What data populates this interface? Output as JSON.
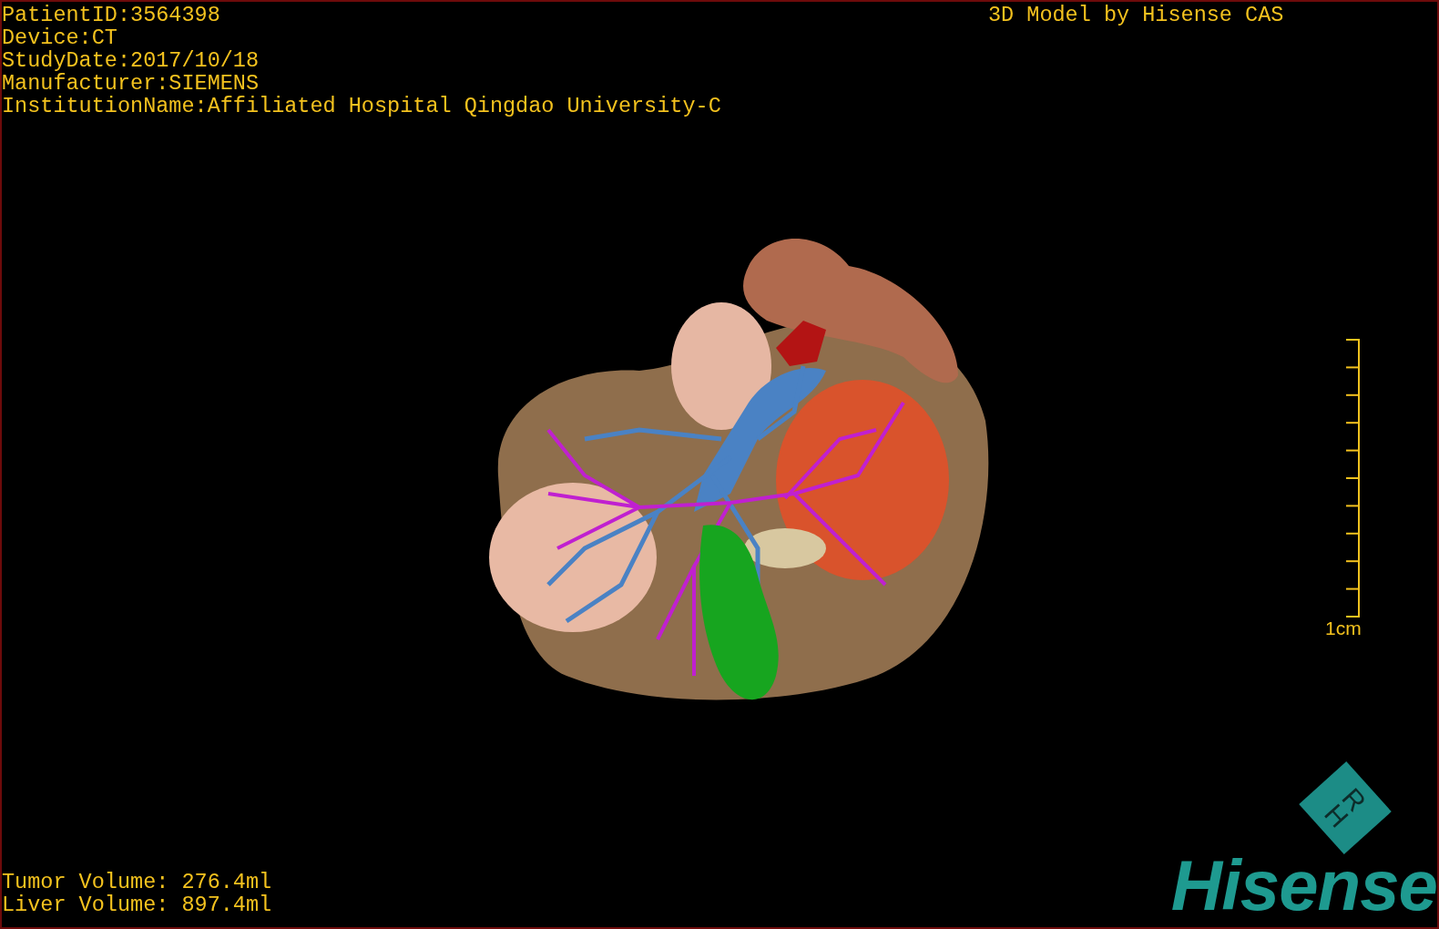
{
  "patient_info": [
    "PatientID:3564398",
    "Device:CT",
    "StudyDate:2017/10/18",
    "Manufacturer:SIEMENS",
    "InstitutionName:Affiliated Hospital Qingdao University-C"
  ],
  "title": "3D Model by Hisense CAS",
  "scale_bar": {
    "label": "1cm"
  },
  "volumes": [
    "Tumor Volume: 276.4ml",
    "Liver Volume: 897.4ml"
  ],
  "orientation_cube": {
    "letters": [
      "H",
      "R"
    ]
  },
  "logo": "Hisense"
}
